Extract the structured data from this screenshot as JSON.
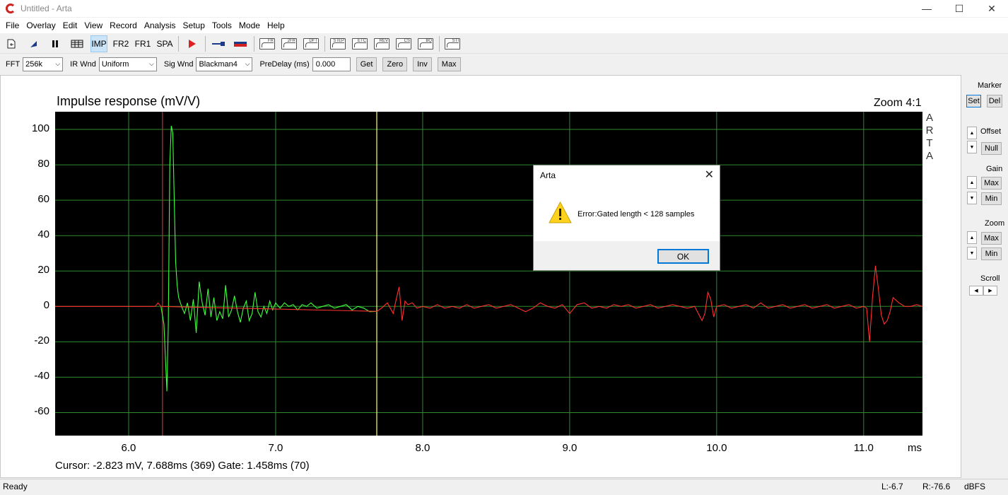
{
  "window": {
    "title": "Untitled - Arta",
    "minimize": "—",
    "maximize": "☐",
    "close": "✕"
  },
  "menu": [
    "File",
    "Overlay",
    "Edit",
    "View",
    "Record",
    "Analysis",
    "Setup",
    "Tools",
    "Mode",
    "Help"
  ],
  "toolbar": {
    "imp": "IMP",
    "fr2": "FR2",
    "fr1": "FR1",
    "spa": "SPA",
    "icons": {
      "fr": "FR",
      "2fr": "2FR",
      "dft": "DFT",
      "step": "STEP",
      "etc": "ETC",
      "rev": "REV",
      "cs": "CS",
      "bq": "BQ",
      "sti": "STI"
    }
  },
  "options": {
    "fft_label": "FFT",
    "fft_value": "256k",
    "irwnd_label": "IR Wnd",
    "irwnd_value": "Uniform",
    "sigwnd_label": "Sig Wnd",
    "sigwnd_value": "Blackman4",
    "predelay_label": "PreDelay (ms)",
    "predelay_value": "0.000",
    "get": "Get",
    "zero": "Zero",
    "inv": "Inv",
    "max": "Max"
  },
  "plot": {
    "title": "Impulse response (mV/V)",
    "zoom": "Zoom 4:1",
    "logo": [
      "A",
      "R",
      "T",
      "A"
    ],
    "yticks": [
      "100",
      "80",
      "60",
      "40",
      "20",
      "0",
      "-20",
      "-40",
      "-60"
    ],
    "xticks": [
      "6.0",
      "7.0",
      "8.0",
      "9.0",
      "10.0",
      "11.0"
    ],
    "xunit": "ms",
    "cursor_text": "Cursor: -2.823 mV, 7.688ms (369)  Gate: 1.458ms (70)"
  },
  "side": {
    "marker": "Marker",
    "set": "Set",
    "del": "Del",
    "offset": "Offset",
    "null": "Null",
    "gain": "Gain",
    "gain_max": "Max",
    "gain_min": "Min",
    "zoom": "Zoom",
    "zoom_max": "Max",
    "zoom_min": "Min",
    "scroll": "Scroll"
  },
  "status": {
    "ready": "Ready",
    "left": "L:-6.7",
    "right": "R:-76.6",
    "unit": "dBFS"
  },
  "dialog": {
    "title": "Arta",
    "message": "Error:Gated length < 128 samples",
    "ok": "OK",
    "close": "✕"
  },
  "chart_data": {
    "type": "line",
    "title": "Impulse response (mV/V)",
    "xlabel": "ms",
    "xlim": [
      5.5,
      11.4
    ],
    "ylim": [
      -73,
      110
    ],
    "grid": true,
    "colors": {
      "gated": "#40ff40",
      "ungated": "#ff3030",
      "grid": "#2e8b2e",
      "marker": "#c03030",
      "cursor": "#ffff99"
    },
    "marker_x": 6.23,
    "cursor_x": 7.688,
    "series": [
      {
        "color": "#40ff40",
        "x": [
          6.22,
          6.24,
          6.26,
          6.27,
          6.28,
          6.29,
          6.3,
          6.31,
          6.32,
          6.33,
          6.34,
          6.36,
          6.38,
          6.4,
          6.42,
          6.44,
          6.46,
          6.48,
          6.5,
          6.52,
          6.54,
          6.56,
          6.58,
          6.6,
          6.62,
          6.64,
          6.66,
          6.68,
          6.7,
          6.72,
          6.74,
          6.76,
          6.78,
          6.8,
          6.82,
          6.84,
          6.86,
          6.88,
          6.9,
          6.92,
          6.94,
          6.96,
          6.98,
          7.0,
          7.03,
          7.06,
          7.09,
          7.12,
          7.15,
          7.18,
          7.21,
          7.24,
          7.28,
          7.32,
          7.36,
          7.4,
          7.44,
          7.48,
          7.52,
          7.56,
          7.6,
          7.64,
          7.688
        ],
        "y": [
          0,
          -10,
          -48,
          -10,
          80,
          102,
          98,
          60,
          25,
          12,
          5,
          0,
          -4,
          2,
          -8,
          4,
          -15,
          14,
          2,
          -5,
          10,
          -6,
          5,
          -8,
          -3,
          -7,
          12,
          -6,
          -2,
          6,
          -3,
          -9,
          -1,
          3,
          -8,
          -4,
          8,
          -3,
          -6,
          0,
          -4,
          3,
          -2,
          2,
          -1,
          2,
          0,
          1,
          -2,
          1,
          0,
          2,
          -1,
          0,
          1,
          -1,
          0,
          1,
          -2,
          0,
          -1,
          -3,
          -2.8
        ]
      },
      {
        "color": "#ff3030",
        "x": [
          5.5,
          6.18,
          6.2,
          6.22,
          7.688,
          7.72,
          7.76,
          7.8,
          7.82,
          7.84,
          7.86,
          7.88,
          7.9,
          7.93,
          7.96,
          8.0,
          8.05,
          8.1,
          8.15,
          8.2,
          8.25,
          8.3,
          8.35,
          8.4,
          8.45,
          8.5,
          8.55,
          8.6,
          8.65,
          8.7,
          8.75,
          8.8,
          8.85,
          8.9,
          8.95,
          9.0,
          9.05,
          9.1,
          9.15,
          9.2,
          9.25,
          9.3,
          9.35,
          9.4,
          9.45,
          9.5,
          9.55,
          9.6,
          9.65,
          9.7,
          9.75,
          9.8,
          9.85,
          9.9,
          9.92,
          9.94,
          9.96,
          9.98,
          10.0,
          10.05,
          10.1,
          10.15,
          10.2,
          10.25,
          10.3,
          10.35,
          10.4,
          10.45,
          10.5,
          10.55,
          10.6,
          10.65,
          10.7,
          10.75,
          10.8,
          10.85,
          10.9,
          10.95,
          11.0,
          11.02,
          11.04,
          11.06,
          11.08,
          11.1,
          11.12,
          11.14,
          11.16,
          11.18,
          11.2,
          11.24,
          11.28,
          11.32,
          11.36,
          11.4
        ],
        "y": [
          0,
          0,
          2,
          0,
          -2.8,
          -1,
          2,
          -4,
          4,
          11,
          -8,
          3,
          1,
          2,
          -1,
          0,
          -1,
          1,
          -1,
          0,
          -1,
          1,
          -1,
          0,
          1,
          -1,
          0,
          1,
          -1,
          -3,
          -1,
          2,
          0,
          -1,
          1,
          -4,
          1,
          2,
          -1,
          0,
          -1,
          1,
          0,
          1,
          -1,
          0,
          1,
          -1,
          0,
          1,
          0,
          -1,
          0,
          -8,
          -4,
          8,
          4,
          -6,
          0,
          1,
          -1,
          0,
          1,
          -1,
          2,
          -1,
          0,
          1,
          -1,
          0,
          1,
          -1,
          0,
          1,
          -1,
          0,
          1,
          -1,
          0,
          -1,
          -20,
          5,
          23,
          10,
          -5,
          -10,
          -8,
          -3,
          5,
          2,
          0,
          0,
          1,
          0
        ]
      }
    ]
  }
}
